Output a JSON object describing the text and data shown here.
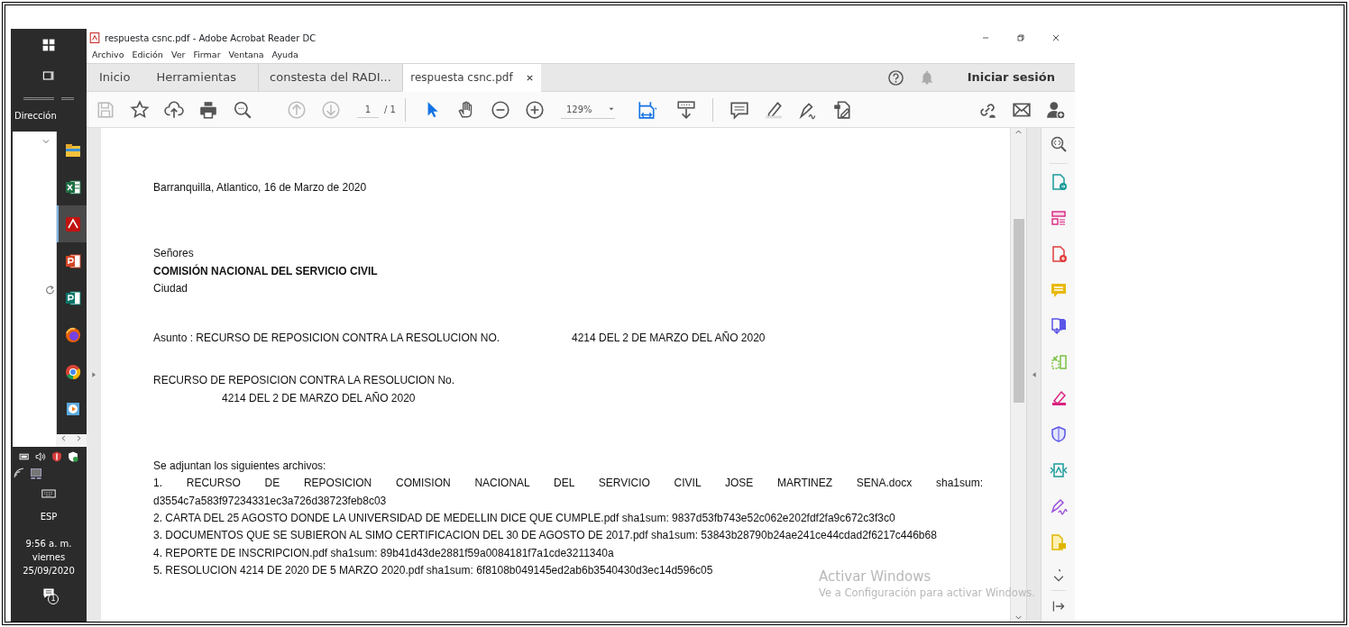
{
  "taskbar": {
    "label": "Dirección",
    "apps": [
      {
        "kind": "folder",
        "selected": false
      },
      {
        "kind": "excel",
        "selected": false
      },
      {
        "kind": "acrobat",
        "selected": true
      },
      {
        "kind": "powerpoint",
        "selected": false
      },
      {
        "kind": "publisher",
        "selected": false
      },
      {
        "kind": "firefox",
        "selected": false
      },
      {
        "kind": "chrome",
        "selected": false
      },
      {
        "kind": "player",
        "selected": false
      }
    ],
    "tray": {
      "language": "ESP",
      "time": "9:56 a. m.",
      "day": "viernes",
      "date": "25/09/2020",
      "notifications": "1"
    }
  },
  "window": {
    "title": "respuesta  csnc.pdf - Adobe Acrobat Reader DC",
    "menu": [
      "Archivo",
      "Edición",
      "Ver",
      "Firmar",
      "Ventana",
      "Ayuda"
    ],
    "tabs": [
      {
        "label": "Inicio",
        "kind": "home",
        "selected": false
      },
      {
        "label": "Herramientas",
        "kind": "home",
        "selected": false
      },
      {
        "label": "constesta del RADI...",
        "kind": "document",
        "selected": false
      },
      {
        "label": "respuesta  csnc.pdf",
        "kind": "document",
        "selected": true
      }
    ],
    "sign_in": "Iniciar sesión",
    "toolbar": {
      "page_current": "1",
      "page_total": "/ 1",
      "zoom": "129%"
    }
  },
  "document": {
    "paragraphs": [
      {
        "lines": [
          {
            "kind": "plain",
            "text": "Barranquilla, Atlantico, 16 de Marzo de 2020"
          }
        ]
      },
      {
        "lines": [
          {
            "kind": "plain",
            "text": "Señores"
          },
          {
            "kind": "bold",
            "text": "COMISIÓN NACIONAL DEL SERVICIO CIVIL"
          },
          {
            "kind": "plain",
            "text": "Ciudad"
          }
        ]
      },
      {
        "lines": [
          {
            "kind": "split",
            "text": "Asunto : RECURSO DE REPOSICION CONTRA LA RESOLUCION NO.",
            "text_2": "4214 DEL 2 DE MARZO DEL AÑO 2020"
          }
        ]
      },
      {
        "lines": [
          {
            "kind": "plain",
            "text": "RECURSO DE REPOSICION CONTRA LA RESOLUCION No."
          },
          {
            "kind": "indented",
            "text": "4214 DEL 2 DE MARZO DEL AÑO 2020"
          }
        ]
      },
      {
        "lines": [
          {
            "kind": "plain",
            "text": "Se adjuntan los siguientes archivos:"
          },
          {
            "kind": "justified",
            "text": "1.    RECURSO    DE    REPOSICION    COMISION    NACIONAL    DEL    SERVICIO    CIVIL    JOSE    MARTINEZ    SENA.docx    sha1sum:"
          },
          {
            "kind": "plain",
            "text": "d3554c7a583f97234331ec3a726d38723feb8c03"
          },
          {
            "kind": "plain",
            "text": "2. CARTA DEL 25 AGOSTO DONDE LA UNIVERSIDAD DE MEDELLIN DICE QUE CUMPLE.pdf  sha1sum: 9837d53fb743e52c062e202fdf2fa9c672c3f3c0"
          },
          {
            "kind": "plain",
            "text": "3. DOCUMENTOS QUE SE SUBIERON AL SIMO CERTIFICACION DEL 30 DE AGOSTO  DE 2017.pdf  sha1sum: 53843b28790b24ae241ce44cdad2f6217c446b68"
          },
          {
            "kind": "plain",
            "text": "4. REPORTE DE INSCRIPCION.pdf  sha1sum: 89b41d43de2881f59a0084181f7a1cde3211340a"
          },
          {
            "kind": "plain",
            "text": "5. RESOLUCION 4214 DE 2020 DE 5 MARZO 2020.pdf  sha1sum: 6f8108b049145ed2ab6b3540430d3ec14d596c05"
          }
        ]
      }
    ]
  },
  "activation_notice": {
    "title": "Activar Windows",
    "text": "Ve a Configuración para activar Windows."
  },
  "tools_pane": [
    {
      "kind": "export"
    },
    {
      "kind": "organize"
    },
    {
      "kind": "create"
    },
    {
      "kind": "comment"
    },
    {
      "kind": "combine"
    },
    {
      "kind": "compress"
    },
    {
      "kind": "highlight"
    },
    {
      "kind": "protect"
    },
    {
      "kind": "optimize"
    },
    {
      "kind": "sign"
    },
    {
      "kind": "notes"
    }
  ]
}
